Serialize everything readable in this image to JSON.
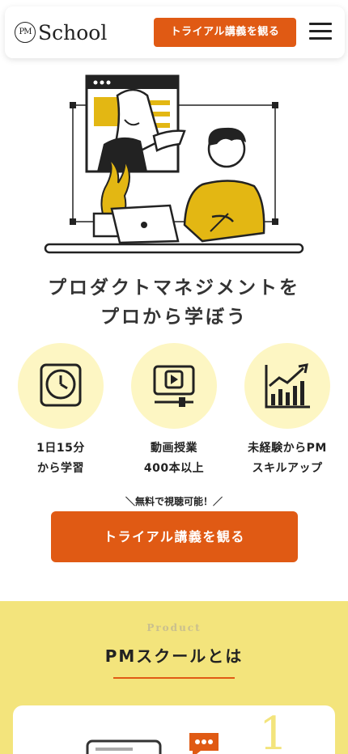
{
  "header": {
    "logo_mark": "PM",
    "logo_text": "School",
    "cta_label": "トライアル講義を観る"
  },
  "hero": {
    "headline_line1": "プロダクトマネジメントを",
    "headline_line2": "プロから学ぼう"
  },
  "features": [
    {
      "icon": "clock-icon",
      "line1": "1日15分",
      "line2": "から学習"
    },
    {
      "icon": "video-player-icon",
      "line1": "動画授業",
      "line2": "400本以上"
    },
    {
      "icon": "bar-chart-icon",
      "line1": "未経験からPM",
      "line2": "スキルアップ"
    }
  ],
  "cta": {
    "note": "＼無料で視聴可能！／",
    "label": "トライアル講義を観る"
  },
  "product": {
    "eyebrow": "Product",
    "title": "PMスクールとは",
    "card_number": "1"
  },
  "colors": {
    "accent": "#e05a14",
    "yellow": "#f3e47c",
    "circle": "#fdf6c3",
    "illustration_yellow": "#e3b713"
  }
}
